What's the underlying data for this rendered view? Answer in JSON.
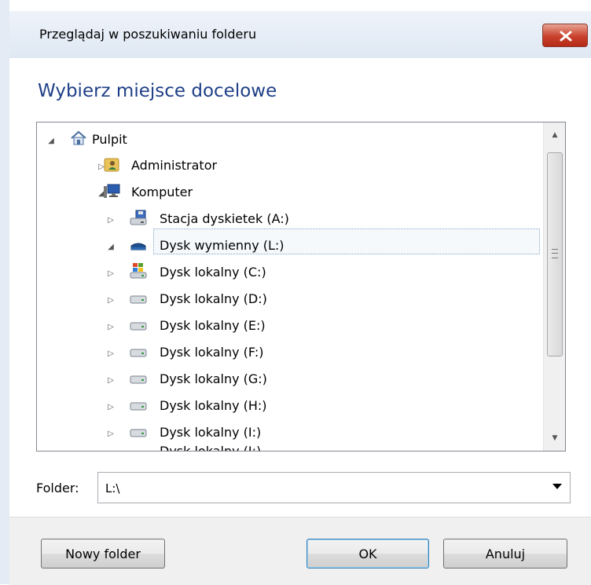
{
  "window": {
    "title": "Przeglądaj w poszukiwaniu folderu",
    "heading": "Wybierz miejsce docelowe"
  },
  "tree": {
    "items": [
      {
        "label": "Pulpit",
        "icon": "desktop-home-icon",
        "expanded": true
      },
      {
        "label": "Administrator",
        "icon": "user-folder-icon",
        "expanded": false
      },
      {
        "label": "Komputer",
        "icon": "computer-icon",
        "expanded": true
      },
      {
        "label": "Stacja dyskietek (A:)",
        "icon": "floppy-drive-icon",
        "expanded": false
      },
      {
        "label": "Dysk wymienny (L:)",
        "icon": "removable-drive-icon",
        "expanded": true,
        "selected": true
      },
      {
        "label": "Dysk lokalny (C:)",
        "icon": "windows-drive-icon",
        "expanded": false
      },
      {
        "label": "Dysk lokalny (D:)",
        "icon": "hard-drive-icon",
        "expanded": false
      },
      {
        "label": "Dysk lokalny (E:)",
        "icon": "hard-drive-icon",
        "expanded": false
      },
      {
        "label": "Dysk lokalny (F:)",
        "icon": "hard-drive-icon",
        "expanded": false
      },
      {
        "label": "Dysk lokalny (G:)",
        "icon": "hard-drive-icon",
        "expanded": false
      },
      {
        "label": "Dysk lokalny (H:)",
        "icon": "hard-drive-icon",
        "expanded": false
      },
      {
        "label": "Dysk lokalny (I:)",
        "icon": "hard-drive-icon",
        "expanded": false
      },
      {
        "label": "Dysk lokalny (J:)",
        "icon": "hard-drive-icon",
        "expanded": false
      }
    ]
  },
  "folder": {
    "label": "Folder:",
    "value": "L:\\"
  },
  "buttons": {
    "new_folder": "Nowy folder",
    "ok": "OK",
    "cancel": "Anuluj"
  },
  "colors": {
    "heading": "#1e3f87",
    "close_button": "#c9412d",
    "selection_border": "#7fa7c9"
  }
}
